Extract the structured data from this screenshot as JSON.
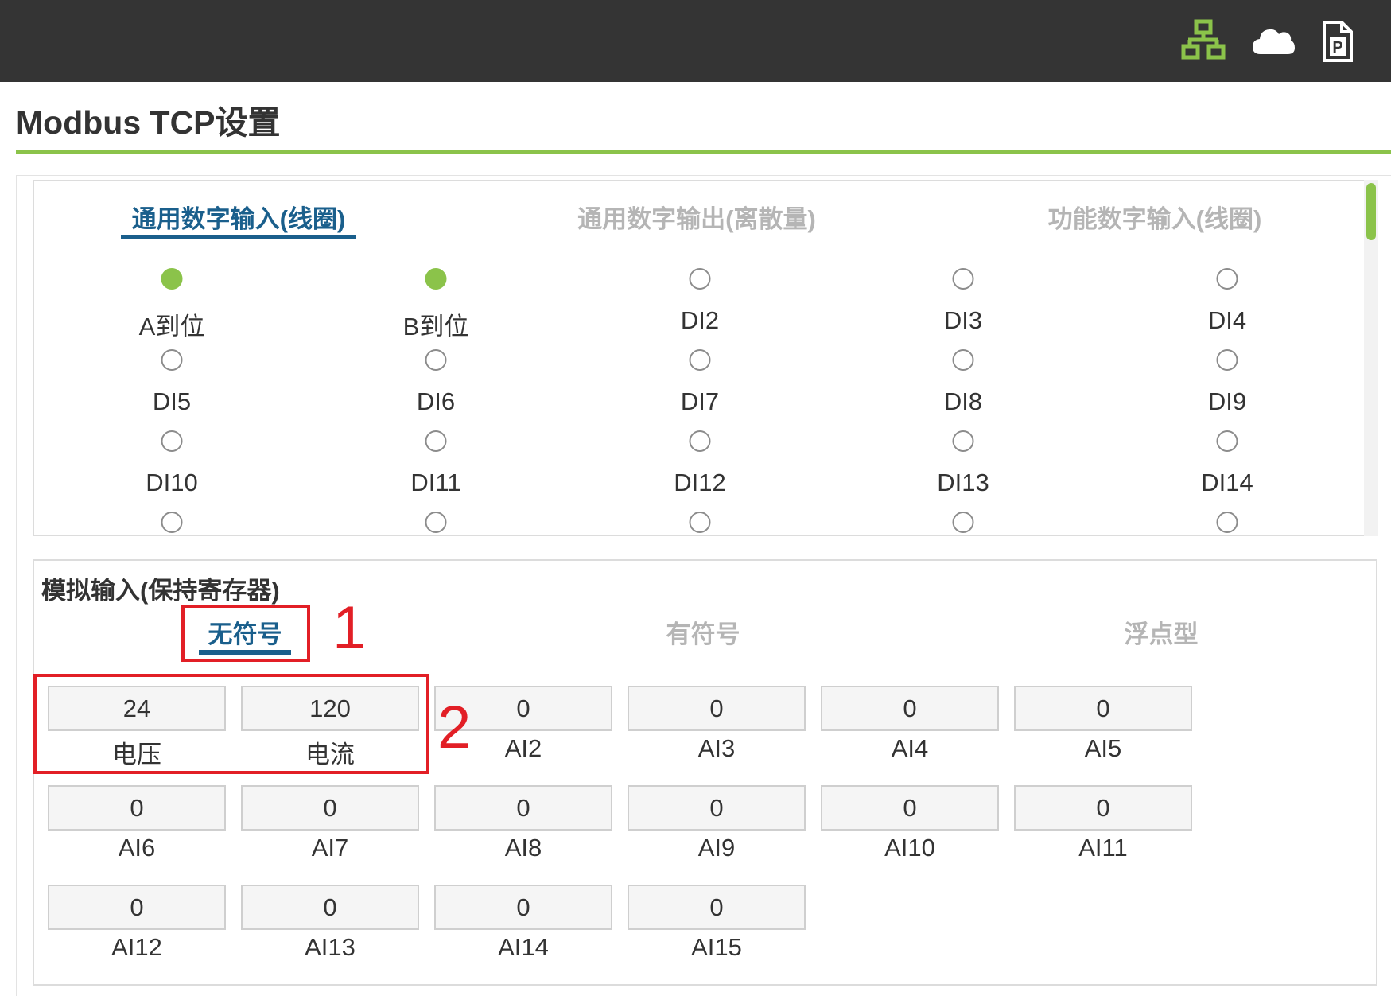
{
  "topbar": {
    "icons": [
      {
        "name": "network-icon",
        "color": "#8bc34a"
      },
      {
        "name": "cloud-icon",
        "color": "#ffffff"
      },
      {
        "name": "pdf-file-icon",
        "color": "#ffffff"
      }
    ]
  },
  "page": {
    "title": "Modbus TCP设置",
    "accent_color": "#8bc34a"
  },
  "digital": {
    "tabs": [
      {
        "label": "通用数字输入(线圈)",
        "active": true
      },
      {
        "label": "通用数字输出(离散量)",
        "active": false
      },
      {
        "label": "功能数字输入(线圈)",
        "active": false
      }
    ],
    "inputs": [
      {
        "label": "A到位",
        "on": true
      },
      {
        "label": "B到位",
        "on": true
      },
      {
        "label": "DI2",
        "on": false
      },
      {
        "label": "DI3",
        "on": false
      },
      {
        "label": "DI4",
        "on": false
      },
      {
        "label": "DI5",
        "on": false
      },
      {
        "label": "DI6",
        "on": false
      },
      {
        "label": "DI7",
        "on": false
      },
      {
        "label": "DI8",
        "on": false
      },
      {
        "label": "DI9",
        "on": false
      },
      {
        "label": "DI10",
        "on": false
      },
      {
        "label": "DI11",
        "on": false
      },
      {
        "label": "DI12",
        "on": false
      },
      {
        "label": "DI13",
        "on": false
      },
      {
        "label": "DI14",
        "on": false
      },
      {
        "label": "",
        "on": false
      },
      {
        "label": "",
        "on": false
      },
      {
        "label": "",
        "on": false
      },
      {
        "label": "",
        "on": false
      },
      {
        "label": "",
        "on": false
      }
    ]
  },
  "analog": {
    "title": "模拟输入(保持寄存器)",
    "tabs": [
      {
        "label": "无符号",
        "active": true
      },
      {
        "label": "有符号",
        "active": false
      },
      {
        "label": "浮点型",
        "active": false
      }
    ],
    "registers": [
      {
        "value": "24",
        "label": "电压"
      },
      {
        "value": "120",
        "label": "电流"
      },
      {
        "value": "0",
        "label": "AI2"
      },
      {
        "value": "0",
        "label": "AI3"
      },
      {
        "value": "0",
        "label": "AI4"
      },
      {
        "value": "0",
        "label": "AI5"
      },
      {
        "value": "0",
        "label": "AI6"
      },
      {
        "value": "0",
        "label": "AI7"
      },
      {
        "value": "0",
        "label": "AI8"
      },
      {
        "value": "0",
        "label": "AI9"
      },
      {
        "value": "0",
        "label": "AI10"
      },
      {
        "value": "0",
        "label": "AI11"
      },
      {
        "value": "0",
        "label": "AI12"
      },
      {
        "value": "0",
        "label": "AI13"
      },
      {
        "value": "0",
        "label": "AI14"
      },
      {
        "value": "0",
        "label": "AI15"
      }
    ]
  },
  "annotations": {
    "marker_1": "1",
    "marker_2": "2",
    "color": "#e21f26"
  }
}
